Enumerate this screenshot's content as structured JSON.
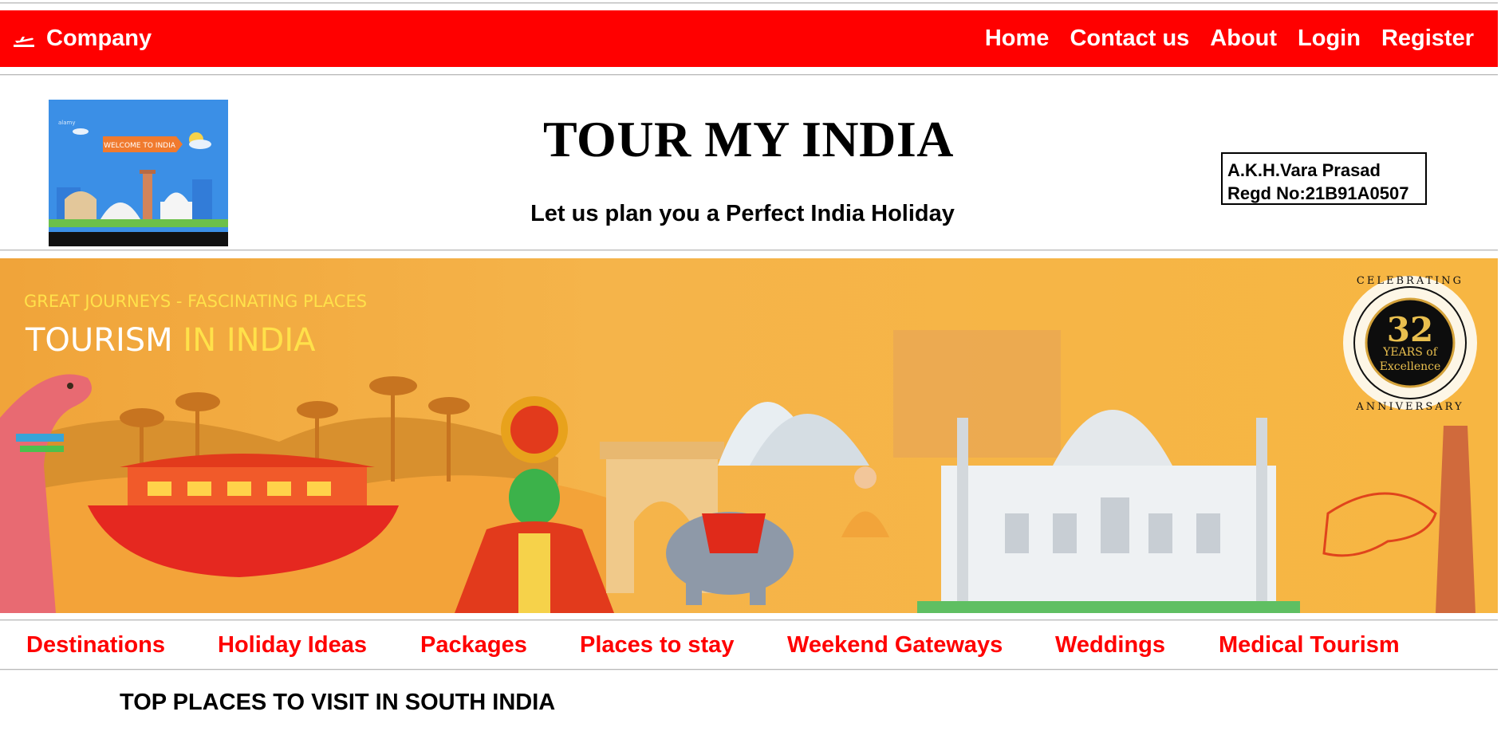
{
  "topnav": {
    "brand": "Company",
    "links": [
      "Home",
      "Contact us",
      "About",
      "Login",
      "Register"
    ]
  },
  "header": {
    "logo_sign": "WELCOME TO INDIA",
    "logo_watermark": "alamy",
    "title": "TOUR MY INDIA",
    "subtitle": "Let us plan you a Perfect India Holiday",
    "student_name": "A.K.H.Vara Prasad",
    "student_regd": "Regd No:21B91A0507"
  },
  "banner": {
    "tagline": "GREAT JOURNEYS - FASCINATING PLACES",
    "heading_part1": "TOURISM ",
    "heading_part2": "IN INDIA",
    "badge_number": "32",
    "badge_line1": "YEARS of",
    "badge_line2": "Excellence",
    "badge_ring_top": "CELEBRATING",
    "badge_ring_bottom": "ANNIVERSARY"
  },
  "categories": [
    "Destinations",
    "Holiday Ideas",
    "Packages",
    "Places to stay",
    "Weekend Gateways",
    "Weddings",
    "Medical Tourism"
  ],
  "section": {
    "heading": "TOP PLACES TO VISIT IN SOUTH INDIA"
  },
  "colors": {
    "nav_bg": "#ff0000",
    "category_text": "#ff0000",
    "banner_bg": "#f7b03c"
  }
}
